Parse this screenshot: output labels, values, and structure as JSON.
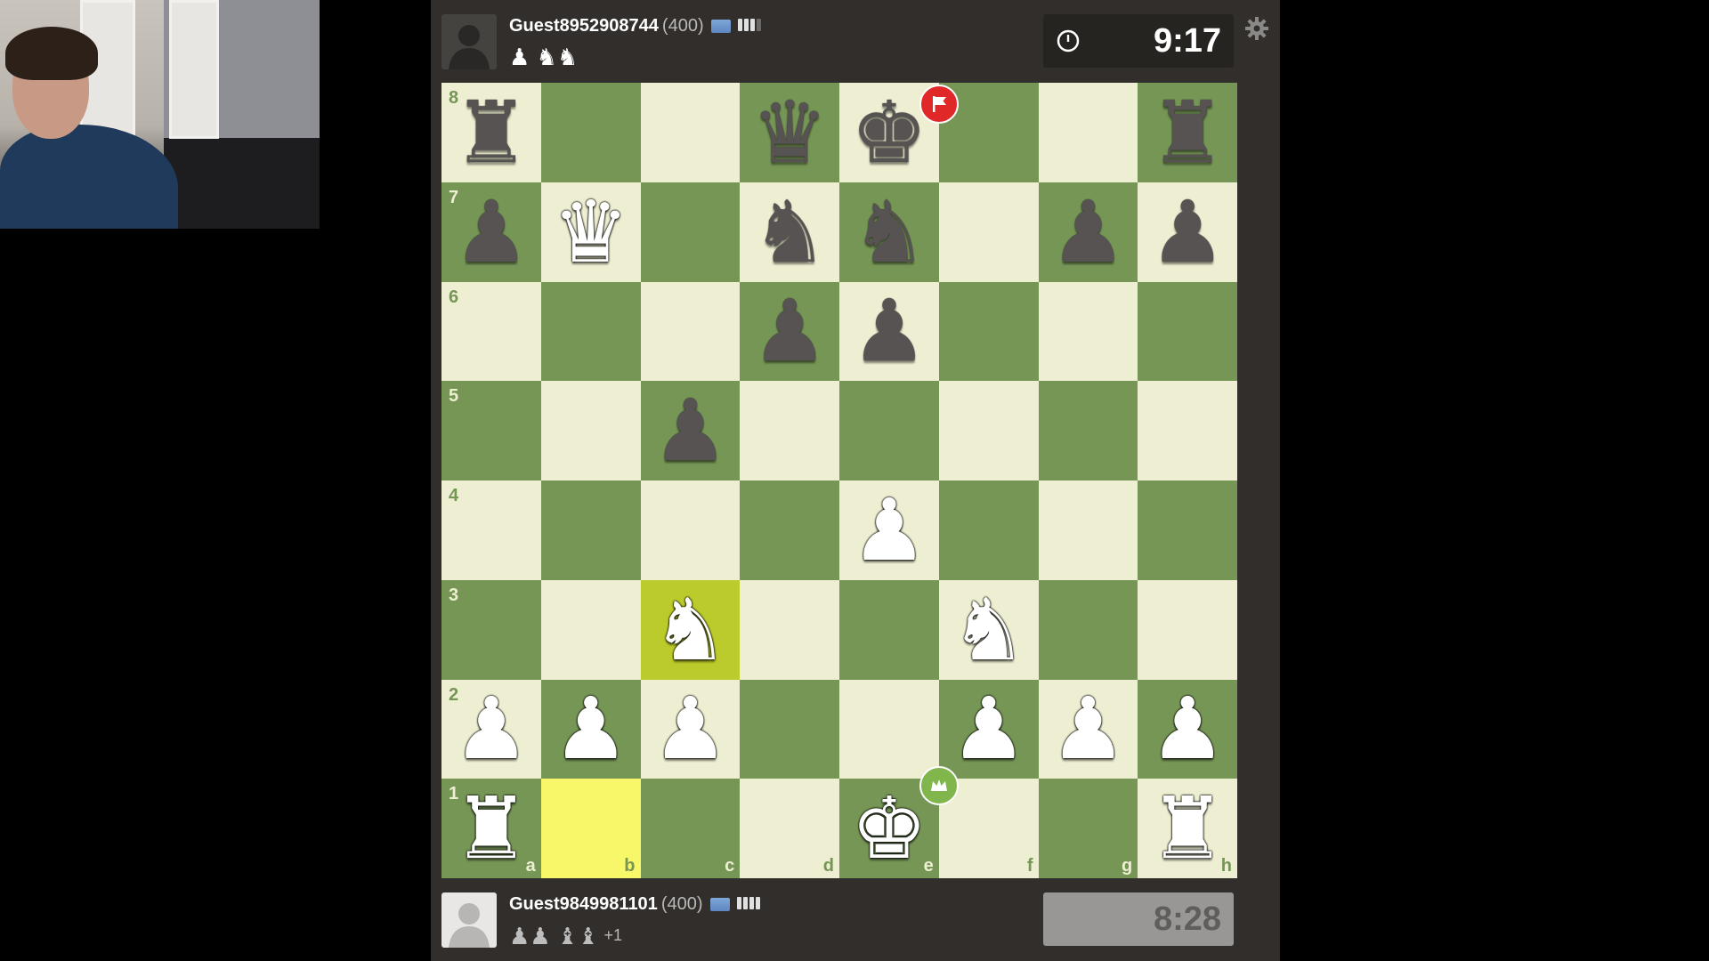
{
  "colors": {
    "light_square": "#eeeed2",
    "dark_square": "#769656",
    "highlight_light": "#f7f769",
    "highlight_dark": "#bbcb2b",
    "panel": "#312e2b"
  },
  "top_player": {
    "name": "Guest8952908744",
    "rating": "(400)",
    "flag_icon": "world-flag-icon",
    "connection_bars": 3,
    "captured": "♟ ♞♞",
    "clock": "9:17",
    "clock_icon": "timer-icon"
  },
  "bottom_player": {
    "name": "Guest9849981101",
    "rating": "(400)",
    "flag_icon": "world-flag-icon",
    "connection_bars": 4,
    "captured": "♟♟ ♝♝",
    "captured_extra": "+1",
    "clock": "8:28"
  },
  "board": {
    "files": [
      "a",
      "b",
      "c",
      "d",
      "e",
      "f",
      "g",
      "h"
    ],
    "ranks": [
      "8",
      "7",
      "6",
      "5",
      "4",
      "3",
      "2",
      "1"
    ],
    "position": [
      [
        "bR",
        "",
        "",
        "bQ",
        "bK",
        "",
        "",
        "bR"
      ],
      [
        "bP",
        "wQ",
        "",
        "bN",
        "bN",
        "",
        "bP",
        "bP"
      ],
      [
        "",
        "",
        "",
        "bP",
        "bP",
        "",
        "",
        ""
      ],
      [
        "",
        "",
        "bP",
        "",
        "",
        "",
        "",
        ""
      ],
      [
        "",
        "",
        "",
        "",
        "wP",
        "",
        "",
        ""
      ],
      [
        "",
        "",
        "wN",
        "",
        "",
        "wN",
        "",
        ""
      ],
      [
        "wP",
        "wP",
        "wP",
        "",
        "",
        "wP",
        "wP",
        "wP"
      ],
      [
        "wR",
        "",
        "",
        "",
        "wK",
        "",
        "",
        "wR"
      ]
    ],
    "highlighted": [
      "c3",
      "b1"
    ],
    "badges": [
      {
        "square": "e8",
        "type": "flag",
        "color": "red",
        "icon": "resign-flag-icon"
      },
      {
        "square": "e1",
        "type": "crown",
        "color": "green",
        "icon": "winner-crown-icon"
      }
    ]
  },
  "settings_icon": "gear-icon"
}
